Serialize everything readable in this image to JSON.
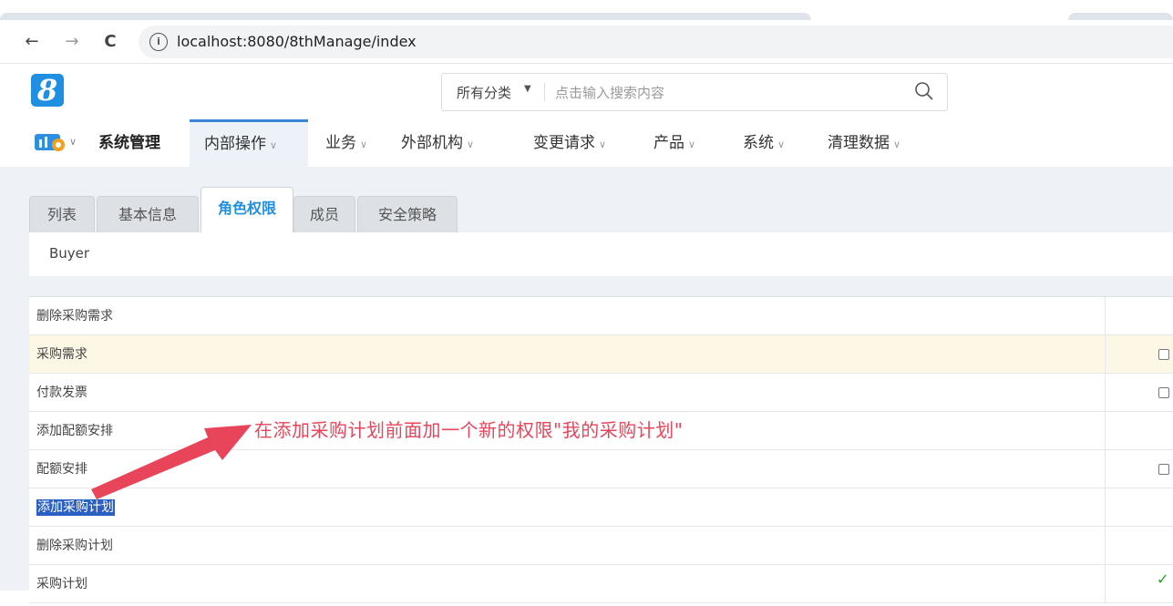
{
  "browser": {
    "url": "localhost:8080/8thManage/index",
    "back": "←",
    "forward": "→",
    "reload": "C",
    "info": "i"
  },
  "logo": {
    "text": "8",
    "color": "#1e8fe1"
  },
  "search": {
    "category": "所有分类",
    "placeholder": "点击输入搜索内容"
  },
  "menu": {
    "system_title": "系统管理",
    "items": [
      {
        "label": "内部操作",
        "active": true
      },
      {
        "label": "业务"
      },
      {
        "label": "外部机构"
      },
      {
        "label": "变更请求"
      },
      {
        "label": "产品"
      },
      {
        "label": "系统"
      },
      {
        "label": "清理数据"
      }
    ]
  },
  "tabs": [
    {
      "label": "列表"
    },
    {
      "label": "基本信息"
    },
    {
      "label": "角色权限",
      "active": true
    },
    {
      "label": "成员"
    },
    {
      "label": "安全策略"
    }
  ],
  "role": {
    "name": "Buyer"
  },
  "permissions": [
    {
      "label": "删除采购需求",
      "state": "none"
    },
    {
      "label": "采购需求",
      "state": "unchecked",
      "highlight": true
    },
    {
      "label": "付款发票",
      "state": "unchecked"
    },
    {
      "label": "添加配额安排",
      "state": "none"
    },
    {
      "label": "配额安排",
      "state": "unchecked"
    },
    {
      "label": "添加采购计划",
      "state": "none",
      "selected": true
    },
    {
      "label": "删除采购计划",
      "state": "none"
    },
    {
      "label": "采购计划",
      "state": "checked"
    }
  ],
  "annotation": {
    "text": "在添加采购计划前面加一个新的权限\"我的采购计划\"",
    "color": "#e8455a"
  },
  "colors": {
    "accent": "#1e8fe1",
    "active_tab_border": "#3b86d6",
    "highlight_row": "#fdf8e6",
    "selection": "#2a5fc4"
  }
}
